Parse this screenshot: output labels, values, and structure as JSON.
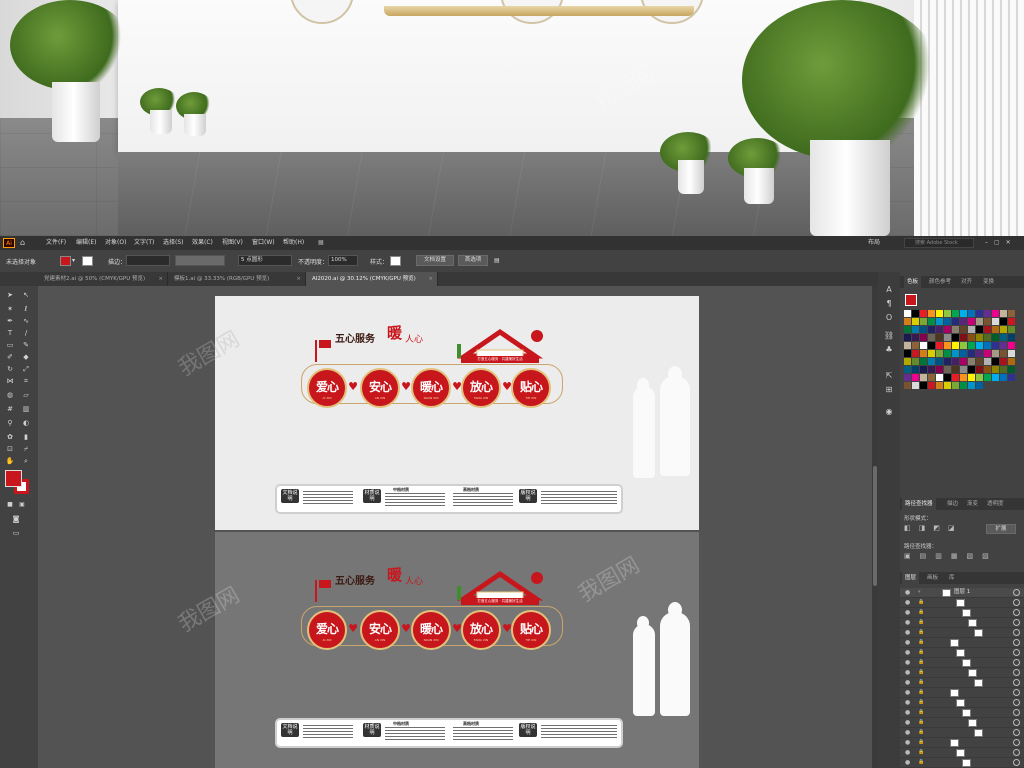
{
  "menubar": {
    "app_icon": "Ai",
    "items": [
      "文件(F)",
      "编辑(E)",
      "对象(O)",
      "文字(T)",
      "选择(S)",
      "效果(C)",
      "视图(V)",
      "窗口(W)",
      "帮助(H)"
    ],
    "workspace": "布局",
    "search_placeholder": "搜索 Adobe Stock"
  },
  "control": {
    "selection_state": "未选择对象",
    "fill_color": "#c8161d",
    "stroke_label": "描边：",
    "brush_label": "5 点圆形",
    "opacity_label": "不透明度：",
    "opacity_value": "100%",
    "style_label": "样式：",
    "doc_setup": "文档设置",
    "preferences": "首选项"
  },
  "tabs": [
    {
      "label": "党建素材2.ai @ 50% (CMYK/GPU 预览)",
      "active": false
    },
    {
      "label": "模板1.ai @ 33.33% (RGB/GPU 预览)",
      "active": false
    },
    {
      "label": "AI2020.ai @ 30.12% (CMYK/GPU 预览)",
      "active": true
    }
  ],
  "swatches_panel": {
    "tabs": [
      "色板",
      "颜色参考",
      "对齐",
      "变换"
    ]
  },
  "pathfinder_panel": {
    "tabs": [
      "路径查找器",
      "描边",
      "渐变",
      "透明度"
    ],
    "shape_modes": "形状模式：",
    "expand": "扩展",
    "pathfinders": "路径查找器："
  },
  "layers_panel": {
    "tabs": [
      "图层",
      "画板",
      "库"
    ],
    "top_layer": "图层 1"
  },
  "artwork": {
    "title": "五心服务",
    "title_emph": "暖",
    "title_tail": "人心",
    "medals": [
      {
        "text": "爱心",
        "sub": "AI XIN"
      },
      {
        "text": "安心",
        "sub": "AN XIN"
      },
      {
        "text": "暖心",
        "sub": "NUAN XIN"
      },
      {
        "text": "放心",
        "sub": "FANG XIN"
      },
      {
        "text": "贴心",
        "sub": "TIE XIN"
      }
    ],
    "banner": "打造五心服务 · 共建美好生活",
    "info": {
      "tag1": "文档说明",
      "tag2": "材质说明",
      "tag3": "版权说明",
      "head1": "文档说明",
      "head2": "中档材质",
      "head3": "高档材质"
    }
  },
  "colors": {
    "accent_red": "#c8161d",
    "gold": "#e3c07a",
    "panel_bg": "#424242",
    "canvas_bg": "#535353"
  },
  "icons": [
    "home-icon",
    "selection-tool-icon",
    "direct-selection-icon",
    "pen-icon",
    "type-icon",
    "line-icon",
    "rectangle-icon",
    "paintbrush-icon",
    "pencil-icon",
    "eraser-icon",
    "rotate-icon",
    "scale-icon",
    "width-icon",
    "free-transform-icon",
    "shape-builder-icon",
    "perspective-icon",
    "mesh-icon",
    "gradient-icon",
    "eyedropper-icon",
    "blend-icon",
    "symbol-sprayer-icon",
    "graph-icon",
    "artboard-icon",
    "slice-icon",
    "hand-icon",
    "zoom-icon",
    "eye-icon",
    "lock-icon"
  ]
}
